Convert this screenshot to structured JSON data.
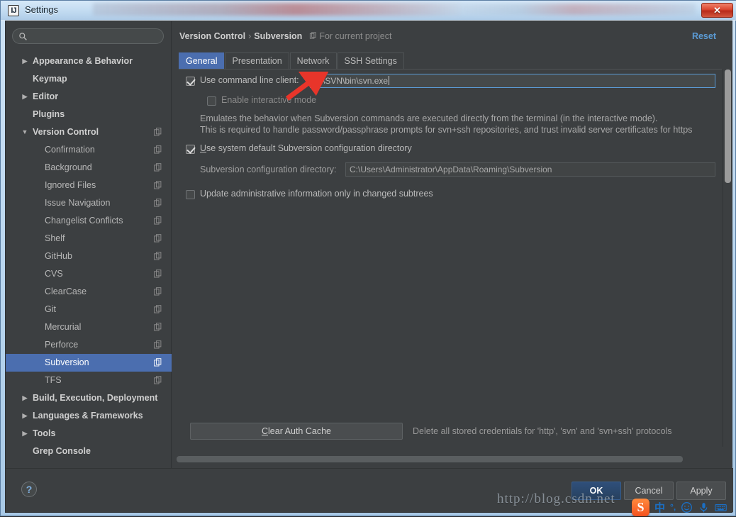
{
  "window": {
    "title": "Settings",
    "app_icon": "intellij-idea-icon",
    "close_label": "✕"
  },
  "sidebar": {
    "search": {
      "placeholder": "",
      "value": "",
      "icon": "search-icon"
    },
    "items": [
      {
        "label": "Appearance & Behavior",
        "level": "top",
        "arrow": "▶",
        "copy": false
      },
      {
        "label": "Keymap",
        "level": "top",
        "arrow": "",
        "copy": false
      },
      {
        "label": "Editor",
        "level": "top",
        "arrow": "▶",
        "copy": false
      },
      {
        "label": "Plugins",
        "level": "top",
        "arrow": "",
        "copy": false
      },
      {
        "label": "Version Control",
        "level": "top",
        "arrow": "▼",
        "copy": true
      },
      {
        "label": "Confirmation",
        "level": "child",
        "arrow": "",
        "copy": true
      },
      {
        "label": "Background",
        "level": "child",
        "arrow": "",
        "copy": true
      },
      {
        "label": "Ignored Files",
        "level": "child",
        "arrow": "",
        "copy": true
      },
      {
        "label": "Issue Navigation",
        "level": "child",
        "arrow": "",
        "copy": true
      },
      {
        "label": "Changelist Conflicts",
        "level": "child",
        "arrow": "",
        "copy": true
      },
      {
        "label": "Shelf",
        "level": "child",
        "arrow": "",
        "copy": true
      },
      {
        "label": "GitHub",
        "level": "child",
        "arrow": "",
        "copy": true
      },
      {
        "label": "CVS",
        "level": "child",
        "arrow": "",
        "copy": true
      },
      {
        "label": "ClearCase",
        "level": "child",
        "arrow": "",
        "copy": true
      },
      {
        "label": "Git",
        "level": "child",
        "arrow": "",
        "copy": true
      },
      {
        "label": "Mercurial",
        "level": "child",
        "arrow": "",
        "copy": true
      },
      {
        "label": "Perforce",
        "level": "child",
        "arrow": "",
        "copy": true
      },
      {
        "label": "Subversion",
        "level": "child",
        "arrow": "",
        "copy": true,
        "selected": true
      },
      {
        "label": "TFS",
        "level": "child",
        "arrow": "",
        "copy": true
      },
      {
        "label": "Build, Execution, Deployment",
        "level": "top",
        "arrow": "▶",
        "copy": false
      },
      {
        "label": "Languages & Frameworks",
        "level": "top",
        "arrow": "▶",
        "copy": false
      },
      {
        "label": "Tools",
        "level": "top",
        "arrow": "▶",
        "copy": false
      },
      {
        "label": "Grep Console",
        "level": "top",
        "arrow": "",
        "copy": false
      }
    ]
  },
  "header": {
    "breadcrumb_parent": "Version Control",
    "breadcrumb_separator": "›",
    "breadcrumb_current": "Subversion",
    "scope_icon": "project-scope-icon",
    "scope_text": "For current project",
    "reset_label": "Reset"
  },
  "tabs": [
    {
      "label": "General",
      "active": true
    },
    {
      "label": "Presentation",
      "active": false
    },
    {
      "label": "Network",
      "active": false
    },
    {
      "label": "SSH Settings",
      "active": false
    }
  ],
  "general": {
    "use_command_line_client": {
      "label": "Use command line client:",
      "checked": true,
      "path_value": "D:\\SVN\\bin\\svn.exe",
      "focused": true
    },
    "enable_interactive_mode": {
      "label": "Enable interactive mode",
      "checked": false,
      "disabled": true
    },
    "description_line_1": "Emulates the behavior when Subversion commands are executed directly from the terminal (in the interactive mode).",
    "description_line_2": "This is required to handle password/passphrase prompts for svn+ssh repositories, and trust invalid server certificates for https",
    "use_system_default_config": {
      "label_prefix": "U",
      "label": "Use system default Subversion configuration directory",
      "checked": true
    },
    "config_directory": {
      "label": "Subversion configuration directory:",
      "value": "C:\\Users\\Administrator\\AppData\\Roaming\\Subversion",
      "readonly": true
    },
    "update_admin_info": {
      "label": "Update administrative information only in changed subtrees",
      "checked": false
    },
    "clear_auth_cache_button": "Clear Auth Cache",
    "clear_auth_cache_note": "Delete all stored credentials for 'http', 'svn' and 'svn+ssh' protocols"
  },
  "footer": {
    "help_label": "?",
    "ok_label": "OK",
    "cancel_label": "Cancel",
    "apply_label": "Apply"
  },
  "overlays": {
    "watermark": "http://blog.csdn.net",
    "ime": {
      "logo": "S",
      "mode": "中",
      "punctuation": "°,",
      "emoji_icon": "smiley-icon",
      "voice_icon": "microphone-icon",
      "keyboard_icon": "keyboard-icon"
    }
  },
  "colors": {
    "accent": "#4b6eaf",
    "link": "#5b9bd5",
    "panel_bg": "#3c3f41",
    "annotation_red": "#e8352a"
  }
}
